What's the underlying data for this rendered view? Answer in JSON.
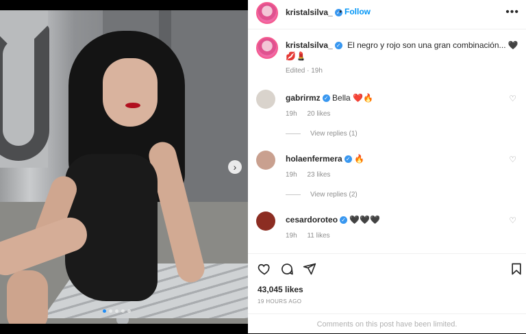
{
  "post": {
    "username": "kristalsilva_",
    "separator": "•",
    "follow_label": "Follow",
    "more_label": "•••",
    "caption": "El negro y rojo son una gran combinación... 🖤💋💄",
    "caption_text": "El negro y rojo son una gran combinación...",
    "caption_emojis": "🖤💋💄",
    "edited": "Edited · 19h"
  },
  "media": {
    "carousel_dots": 5,
    "active_dot": 0,
    "next_icon": "chevron-right-icon"
  },
  "comments": [
    {
      "username": "gabrirmz",
      "text": "Bella",
      "emojis": "❤️🔥",
      "time": "19h",
      "likes": "20 likes",
      "replies": "View replies (1)",
      "avatar_color": "#d9d3cc"
    },
    {
      "username": "holaenfermera",
      "text": "",
      "emojis": "🔥",
      "time": "19h",
      "likes": "23 likes",
      "replies": "View replies (2)",
      "avatar_color": "#c9a08f"
    },
    {
      "username": "cesardoroteo",
      "text": "",
      "emojis": "🖤🖤🖤",
      "time": "19h",
      "likes": "11 likes",
      "replies": "",
      "avatar_color": "#8c2d22"
    }
  ],
  "actions": {
    "like_icon": "heart-icon",
    "comment_icon": "comment-icon",
    "share_icon": "share-icon",
    "save_icon": "bookmark-icon"
  },
  "stats": {
    "likes": "43,045 likes",
    "time_ago": "19 HOURS AGO"
  },
  "footer": {
    "limited_text": "Comments on this post have been limited."
  },
  "colors": {
    "accent": "#0095f6",
    "verified": "#3897f0",
    "muted": "#8e8e8e"
  }
}
